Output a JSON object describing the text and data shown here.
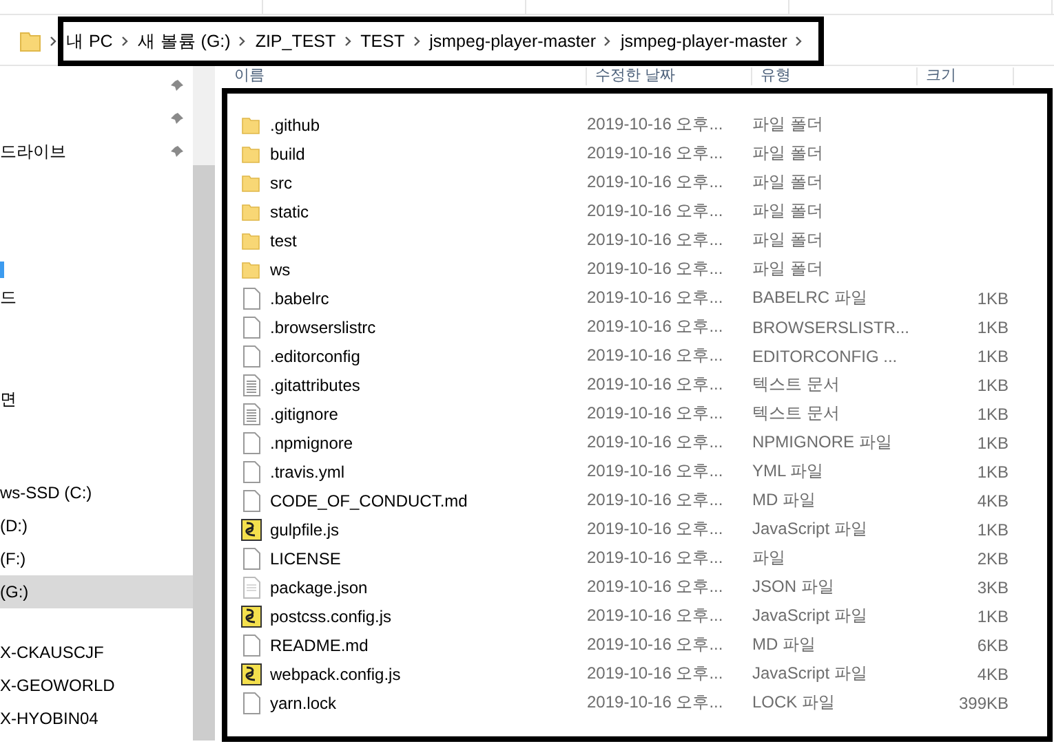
{
  "address_bar": {
    "crumbs": [
      "내 PC",
      "새 볼륨 (G:)",
      "ZIP_TEST",
      "TEST",
      "jsmpeg-player-master",
      "jsmpeg-player-master"
    ]
  },
  "sidebar": {
    "sections": [
      {
        "items": [
          {
            "pinned": true,
            "selected": false
          },
          {
            "pinned": true,
            "selected": false
          },
          {
            "label": "드라이브",
            "pinned": true,
            "selected": false
          }
        ]
      },
      {
        "items": [
          {
            "kind": "marker",
            "selected": false
          },
          {
            "label": "드",
            "selected": false
          }
        ]
      },
      {
        "items": [
          {
            "label": "면",
            "selected": false
          }
        ]
      },
      {
        "items": [
          {
            "label": "ws-SSD (C:)",
            "selected": false
          },
          {
            "label": "(D:)",
            "selected": false
          },
          {
            "label": "(F:)",
            "selected": false
          },
          {
            "label": "(G:)",
            "selected": true
          }
        ]
      },
      {
        "items": [
          {
            "label": "X-CKAUSCJF",
            "selected": false
          },
          {
            "label": "X-GEOWORLD",
            "selected": false
          },
          {
            "label": "X-HYOBIN04",
            "selected": false
          }
        ]
      }
    ]
  },
  "table": {
    "columns": [
      "이름",
      "수정한 날짜",
      "유형",
      "크기"
    ],
    "rows": [
      {
        "kind": "folder",
        "name": ".github",
        "date": "2019-10-16 오후...",
        "type": "파일 폴더"
      },
      {
        "kind": "folder",
        "name": "build",
        "date": "2019-10-16 오후...",
        "type": "파일 폴더"
      },
      {
        "kind": "folder",
        "name": "src",
        "date": "2019-10-16 오후...",
        "type": "파일 폴더"
      },
      {
        "kind": "folder",
        "name": "static",
        "date": "2019-10-16 오후...",
        "type": "파일 폴더"
      },
      {
        "kind": "folder",
        "name": "test",
        "date": "2019-10-16 오후...",
        "type": "파일 폴더"
      },
      {
        "kind": "folder",
        "name": "ws",
        "date": "2019-10-16 오후...",
        "type": "파일 폴더"
      },
      {
        "kind": "file",
        "name": ".babelrc",
        "date": "2019-10-16 오후...",
        "type": "BABELRC 파일",
        "size": "1KB"
      },
      {
        "kind": "file",
        "name": ".browserslistrc",
        "date": "2019-10-16 오후...",
        "type": "BROWSERSLISTR...",
        "size": "1KB"
      },
      {
        "kind": "file",
        "name": ".editorconfig",
        "date": "2019-10-16 오후...",
        "type": "EDITORCONFIG ...",
        "size": "1KB"
      },
      {
        "kind": "text",
        "name": ".gitattributes",
        "date": "2019-10-16 오후...",
        "type": "텍스트 문서",
        "size": "1KB"
      },
      {
        "kind": "text",
        "name": ".gitignore",
        "date": "2019-10-16 오후...",
        "type": "텍스트 문서",
        "size": "1KB"
      },
      {
        "kind": "file",
        "name": ".npmignore",
        "date": "2019-10-16 오후...",
        "type": "NPMIGNORE 파일",
        "size": "1KB"
      },
      {
        "kind": "file",
        "name": ".travis.yml",
        "date": "2019-10-16 오후...",
        "type": "YML 파일",
        "size": "1KB"
      },
      {
        "kind": "file",
        "name": "CODE_OF_CONDUCT.md",
        "date": "2019-10-16 오후...",
        "type": "MD 파일",
        "size": "4KB"
      },
      {
        "kind": "script",
        "name": "gulpfile.js",
        "date": "2019-10-16 오후...",
        "type": "JavaScript 파일",
        "size": "1KB"
      },
      {
        "kind": "file",
        "name": "LICENSE",
        "date": "2019-10-16 오후...",
        "type": "파일",
        "size": "2KB"
      },
      {
        "kind": "json",
        "name": "package.json",
        "date": "2019-10-16 오후...",
        "type": "JSON 파일",
        "size": "3KB"
      },
      {
        "kind": "script",
        "name": "postcss.config.js",
        "date": "2019-10-16 오후...",
        "type": "JavaScript 파일",
        "size": "1KB"
      },
      {
        "kind": "file",
        "name": "README.md",
        "date": "2019-10-16 오후...",
        "type": "MD 파일",
        "size": "6KB"
      },
      {
        "kind": "script",
        "name": "webpack.config.js",
        "date": "2019-10-16 오후...",
        "type": "JavaScript 파일",
        "size": "4KB"
      },
      {
        "kind": "file",
        "name": "yarn.lock",
        "date": "2019-10-16 오후...",
        "type": "LOCK 파일",
        "size": "399KB"
      }
    ]
  }
}
